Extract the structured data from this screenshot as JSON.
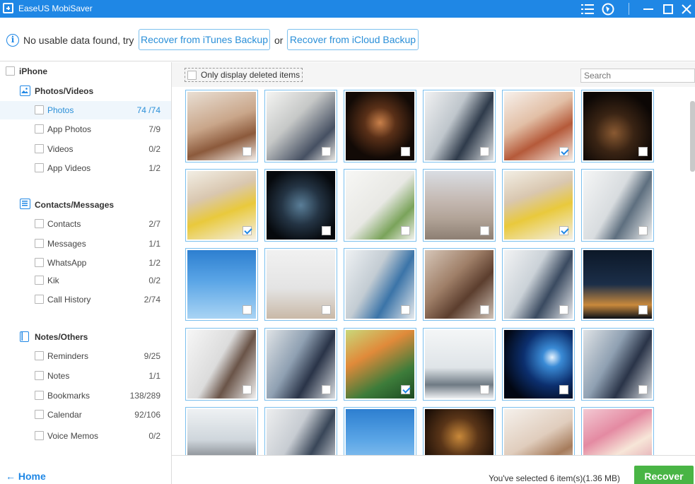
{
  "window": {
    "title": "EaseUS MobiSaver"
  },
  "notice": {
    "text_before": "No usable data found, try",
    "itunes_button": "Recover from iTunes Backup",
    "or_text": "or",
    "icloud_button": "Recover from iCloud Backup"
  },
  "sidebar": {
    "device": "iPhone",
    "categories": [
      {
        "name": "Photos/Videos",
        "icon": "photo-icon",
        "items": [
          {
            "label": "Photos",
            "count": "74 /74",
            "active": true
          },
          {
            "label": "App Photos",
            "count": "7/9"
          },
          {
            "label": "Videos",
            "count": "0/2"
          },
          {
            "label": "App Videos",
            "count": "1/2"
          }
        ]
      },
      {
        "name": "Contacts/Messages",
        "icon": "contacts-icon",
        "items": [
          {
            "label": "Contacts",
            "count": "2/7"
          },
          {
            "label": "Messages",
            "count": "1/1"
          },
          {
            "label": "WhatsApp",
            "count": "1/2"
          },
          {
            "label": "Kik",
            "count": "0/2"
          },
          {
            "label": "Call History",
            "count": "2/74"
          }
        ]
      },
      {
        "name": "Notes/Others",
        "icon": "notes-icon",
        "items": [
          {
            "label": "Reminders",
            "count": "9/25"
          },
          {
            "label": "Notes",
            "count": "1/1"
          },
          {
            "label": "Bookmarks",
            "count": "138/289"
          },
          {
            "label": "Calendar",
            "count": "92/106"
          },
          {
            "label": "Voice Memos",
            "count": "0/2"
          }
        ]
      }
    ],
    "home_label": "Home"
  },
  "toolbar": {
    "filter_label": "Only display deleted items",
    "search_placeholder": "Search"
  },
  "photos": [
    {
      "subject": "family-laptop",
      "checked": false
    },
    {
      "subject": "office-window",
      "checked": false
    },
    {
      "subject": "night-laptop",
      "checked": false
    },
    {
      "subject": "man-desk",
      "checked": false
    },
    {
      "subject": "mother-child-gift",
      "checked": true
    },
    {
      "subject": "dark-laptop",
      "checked": false
    },
    {
      "subject": "mother-child-flowers",
      "checked": true
    },
    {
      "subject": "city-night-laptop",
      "checked": false
    },
    {
      "subject": "white-interior-plant",
      "checked": false
    },
    {
      "subject": "wood-bokeh",
      "checked": false
    },
    {
      "subject": "mother-child-flowers",
      "checked": true
    },
    {
      "subject": "man-computer",
      "checked": false
    },
    {
      "subject": "blue-sky",
      "checked": false
    },
    {
      "subject": "white-room",
      "checked": false
    },
    {
      "subject": "man-laptop",
      "checked": false
    },
    {
      "subject": "meeting-room",
      "checked": false
    },
    {
      "subject": "two-men-laptop",
      "checked": false
    },
    {
      "subject": "city-night",
      "checked": false
    },
    {
      "subject": "woman-laptop",
      "checked": false
    },
    {
      "subject": "team-computer",
      "checked": false
    },
    {
      "subject": "woman-umbrella",
      "checked": true
    },
    {
      "subject": "business-handshake",
      "checked": false
    },
    {
      "subject": "earth-space",
      "checked": false
    },
    {
      "subject": "team-computer",
      "checked": false
    },
    {
      "subject": "conference-table",
      "checked": false
    },
    {
      "subject": "man-office",
      "checked": false
    },
    {
      "subject": "blue-sky",
      "checked": false
    },
    {
      "subject": "dark-restaurant",
      "checked": false
    },
    {
      "subject": "family-room",
      "checked": false
    },
    {
      "subject": "pink-roses-card",
      "checked": false
    }
  ],
  "footer": {
    "selection_text": "You've selected 6 item(s)(1.36 MB)",
    "recover_button": "Recover"
  },
  "colors": {
    "accent": "#1f87e5",
    "recover_green": "#49b545",
    "thumb_border": "#7cc0ee"
  }
}
